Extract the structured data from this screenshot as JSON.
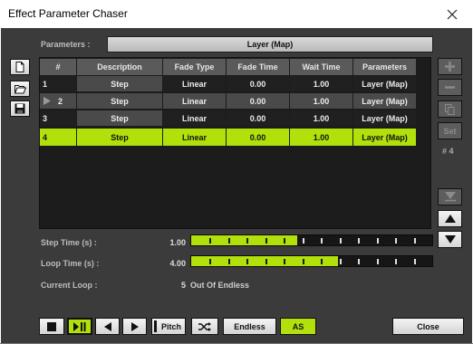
{
  "window": {
    "title": "Effect Parameter Chaser"
  },
  "params": {
    "label": "Parameters :",
    "value": "Layer (Map)"
  },
  "table": {
    "columns": [
      "#",
      "Description",
      "Fade Type",
      "Fade Time",
      "Wait Time",
      "Parameters"
    ],
    "rows": [
      {
        "num": "1",
        "desc": "Step",
        "fade_type": "Linear",
        "fade_time": "0.00",
        "wait_time": "1.00",
        "parameters": "Layer (Map)"
      },
      {
        "num": "2",
        "desc": "Step",
        "fade_type": "Linear",
        "fade_time": "0.00",
        "wait_time": "1.00",
        "parameters": "Layer (Map)"
      },
      {
        "num": "3",
        "desc": "Step",
        "fade_type": "Linear",
        "fade_time": "0.00",
        "wait_time": "1.00",
        "parameters": "Layer (Map)"
      },
      {
        "num": "4",
        "desc": "Step",
        "fade_type": "Linear",
        "fade_time": "0.00",
        "wait_time": "1.00",
        "parameters": "Layer (Map)"
      }
    ],
    "selected_row": 4,
    "playing_row": 2
  },
  "right": {
    "set_label": "Set",
    "count_label": "# 4"
  },
  "step_time": {
    "label": "Step Time (s) :",
    "value": "1.00",
    "fill": 0.44
  },
  "loop_time": {
    "label": "Loop Time (s) :",
    "value": "4.00",
    "fill": 0.61
  },
  "current_loop": {
    "label": "Current Loop :",
    "value": "5",
    "suffix": "Out Of Endless"
  },
  "bottom": {
    "pitch_label": "Pitch",
    "endless_label": "Endless",
    "as_label": "AS",
    "close_label": "Close"
  },
  "colors": {
    "accent": "#b2e00a",
    "background": "#3b3b3b",
    "table_bg": "#1c1c1c"
  },
  "icons": [
    "new-file-icon",
    "open-folder-icon",
    "save-icon",
    "plus-icon",
    "minus-icon",
    "copy-icon",
    "arrow-down-double-icon",
    "arrow-up-icon",
    "arrow-down-icon",
    "stop-icon",
    "play-pause-icon",
    "previous-icon",
    "next-icon",
    "shuffle-icon",
    "close-icon"
  ]
}
